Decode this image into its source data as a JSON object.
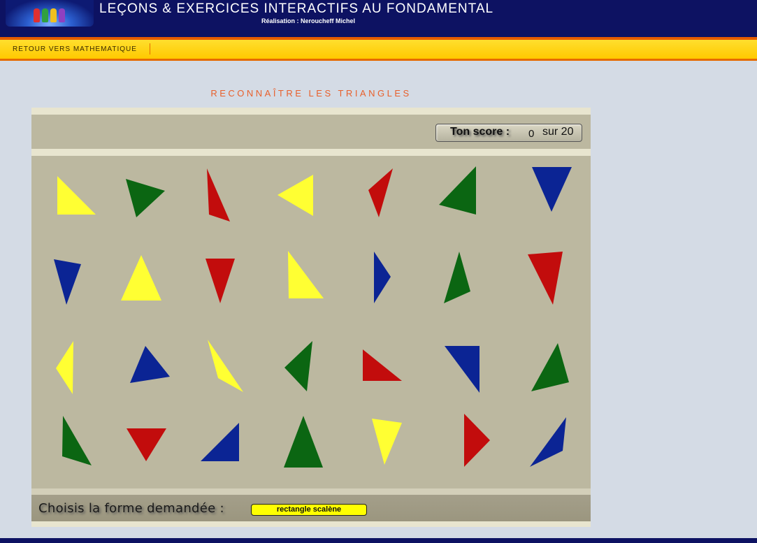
{
  "header": {
    "title": "LEÇONS & EXERCICES INTERACTIFS AU FONDAMENTAL",
    "subtitle": "Réalisation : Neroucheff Michel"
  },
  "nav": {
    "back_link": "RETOUR VERS MATHEMATIQUE"
  },
  "page": {
    "title": "RECONNAÎTRE LES TRIANGLES"
  },
  "score": {
    "label": "Ton score :",
    "value": "0",
    "total": "sur 20"
  },
  "colors": {
    "yellow": "#ffff33",
    "green": "#0b6612",
    "red": "#c20c0c",
    "blue": "#0b2494"
  },
  "triangles": [
    {
      "color": "yellow"
    },
    {
      "color": "green"
    },
    {
      "color": "red"
    },
    {
      "color": "yellow"
    },
    {
      "color": "red"
    },
    {
      "color": "green"
    },
    {
      "color": "blue"
    },
    {
      "color": "blue"
    },
    {
      "color": "yellow"
    },
    {
      "color": "red"
    },
    {
      "color": "yellow"
    },
    {
      "color": "blue"
    },
    {
      "color": "green"
    },
    {
      "color": "red"
    },
    {
      "color": "yellow"
    },
    {
      "color": "blue"
    },
    {
      "color": "yellow"
    },
    {
      "color": "green"
    },
    {
      "color": "red"
    },
    {
      "color": "blue"
    },
    {
      "color": "green"
    },
    {
      "color": "green"
    },
    {
      "color": "red"
    },
    {
      "color": "blue"
    },
    {
      "color": "green"
    },
    {
      "color": "yellow"
    },
    {
      "color": "red"
    },
    {
      "color": "blue"
    }
  ],
  "task": {
    "prompt": "Choisis la forme demandée :",
    "target": "rectangle scalène"
  }
}
